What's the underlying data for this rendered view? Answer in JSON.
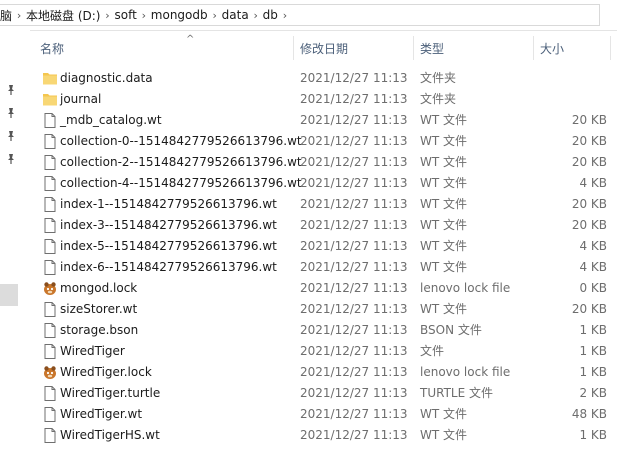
{
  "address_bar": {
    "crumbs": [
      "脑",
      "本地磁盘 (D:)",
      "soft",
      "mongodb",
      "data",
      "db"
    ]
  },
  "columns": {
    "name": "名称",
    "date": "修改日期",
    "type": "类型",
    "size": "大小"
  },
  "files": [
    {
      "name": "diagnostic.data",
      "date": "2021/12/27 11:13",
      "type": "文件夹",
      "size": "",
      "icon": "folder-icon"
    },
    {
      "name": "journal",
      "date": "2021/12/27 11:13",
      "type": "文件夹",
      "size": "",
      "icon": "folder-icon"
    },
    {
      "name": "_mdb_catalog.wt",
      "date": "2021/12/27 11:13",
      "type": "WT 文件",
      "size": "20 KB",
      "icon": "file-icon"
    },
    {
      "name": "collection-0--1514842779526613796.wt",
      "date": "2021/12/27 11:13",
      "type": "WT 文件",
      "size": "20 KB",
      "icon": "file-icon"
    },
    {
      "name": "collection-2--1514842779526613796.wt",
      "date": "2021/12/27 11:13",
      "type": "WT 文件",
      "size": "20 KB",
      "icon": "file-icon"
    },
    {
      "name": "collection-4--1514842779526613796.wt",
      "date": "2021/12/27 11:13",
      "type": "WT 文件",
      "size": "4 KB",
      "icon": "file-icon"
    },
    {
      "name": "index-1--1514842779526613796.wt",
      "date": "2021/12/27 11:13",
      "type": "WT 文件",
      "size": "20 KB",
      "icon": "file-icon"
    },
    {
      "name": "index-3--1514842779526613796.wt",
      "date": "2021/12/27 11:13",
      "type": "WT 文件",
      "size": "20 KB",
      "icon": "file-icon"
    },
    {
      "name": "index-5--1514842779526613796.wt",
      "date": "2021/12/27 11:13",
      "type": "WT 文件",
      "size": "4 KB",
      "icon": "file-icon"
    },
    {
      "name": "index-6--1514842779526613796.wt",
      "date": "2021/12/27 11:13",
      "type": "WT 文件",
      "size": "4 KB",
      "icon": "file-icon"
    },
    {
      "name": "mongod.lock",
      "date": "2021/12/27 11:13",
      "type": "lenovo lock file",
      "size": "0 KB",
      "icon": "lock-file-icon"
    },
    {
      "name": "sizeStorer.wt",
      "date": "2021/12/27 11:13",
      "type": "WT 文件",
      "size": "20 KB",
      "icon": "file-icon"
    },
    {
      "name": "storage.bson",
      "date": "2021/12/27 11:13",
      "type": "BSON 文件",
      "size": "1 KB",
      "icon": "file-icon"
    },
    {
      "name": "WiredTiger",
      "date": "2021/12/27 11:13",
      "type": "文件",
      "size": "1 KB",
      "icon": "file-icon"
    },
    {
      "name": "WiredTiger.lock",
      "date": "2021/12/27 11:13",
      "type": "lenovo lock file",
      "size": "1 KB",
      "icon": "lock-file-icon"
    },
    {
      "name": "WiredTiger.turtle",
      "date": "2021/12/27 11:13",
      "type": "TURTLE 文件",
      "size": "2 KB",
      "icon": "file-icon"
    },
    {
      "name": "WiredTiger.wt",
      "date": "2021/12/27 11:13",
      "type": "WT 文件",
      "size": "48 KB",
      "icon": "file-icon"
    },
    {
      "name": "WiredTigerHS.wt",
      "date": "2021/12/27 11:13",
      "type": "WT 文件",
      "size": "1 KB",
      "icon": "file-icon"
    }
  ],
  "colors": {
    "folder": "#f4c64f",
    "header_text": "#4c607a",
    "secondary_text": "#6d6d6d"
  }
}
